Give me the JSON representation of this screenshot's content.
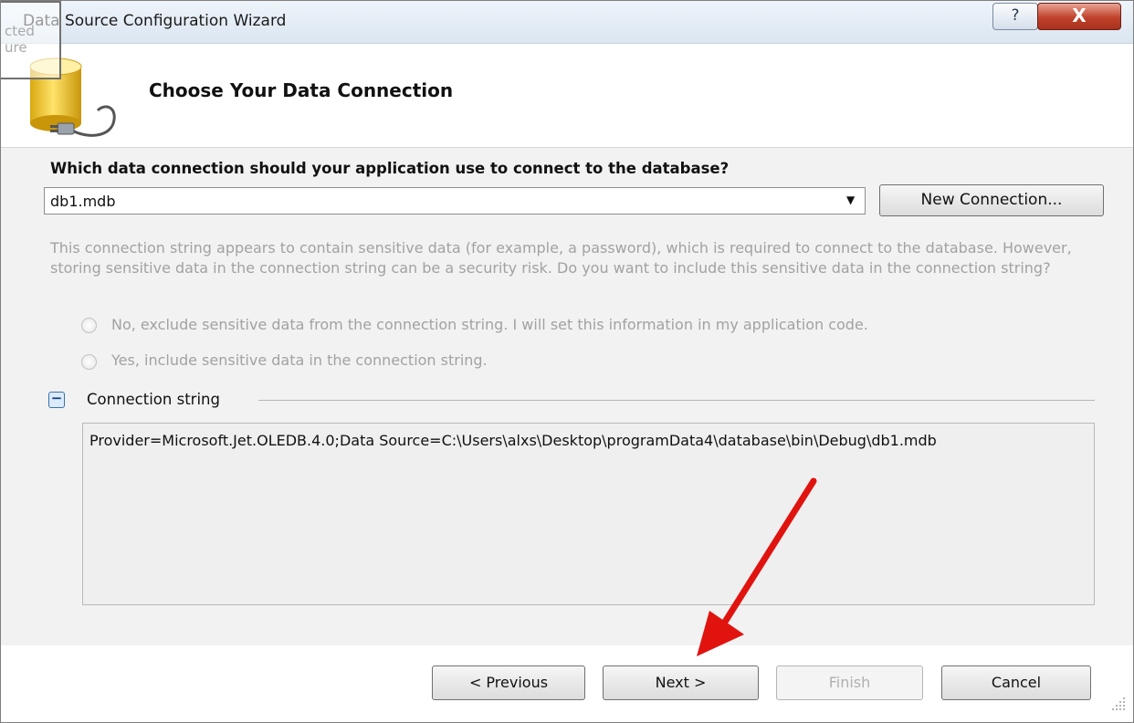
{
  "window": {
    "title": "Data Source Configuration Wizard",
    "help_glyph": "?",
    "close_glyph": "X"
  },
  "background_fragment": {
    "line1": "cted",
    "line2": "ure"
  },
  "header": {
    "title": "Choose Your Data Connection",
    "icon": "database-plug-icon"
  },
  "connection": {
    "question": "Which data connection should your application use to connect to the database?",
    "selected": "db1.mdb",
    "new_connection_label": "New Connection...",
    "sensitive_info": "This connection string appears to contain sensitive data (for example, a password), which is required to connect to the database. However, storing sensitive data in the connection string can be a security risk. Do you want to include this sensitive data in the connection string?",
    "radio_no": "No, exclude sensitive data from the connection string. I will set this information in my application code.",
    "radio_yes": "Yes, include sensitive data in the connection string.",
    "section_label": "Connection string",
    "collapse_glyph": "−",
    "connection_string": "Provider=Microsoft.Jet.OLEDB.4.0;Data Source=C:\\Users\\alxs\\Desktop\\programData4\\database\\bin\\Debug\\db1.mdb"
  },
  "buttons": {
    "previous": "< Previous",
    "next": "Next >",
    "finish": "Finish",
    "cancel": "Cancel"
  },
  "annotation": {
    "color": "#e0130f"
  }
}
